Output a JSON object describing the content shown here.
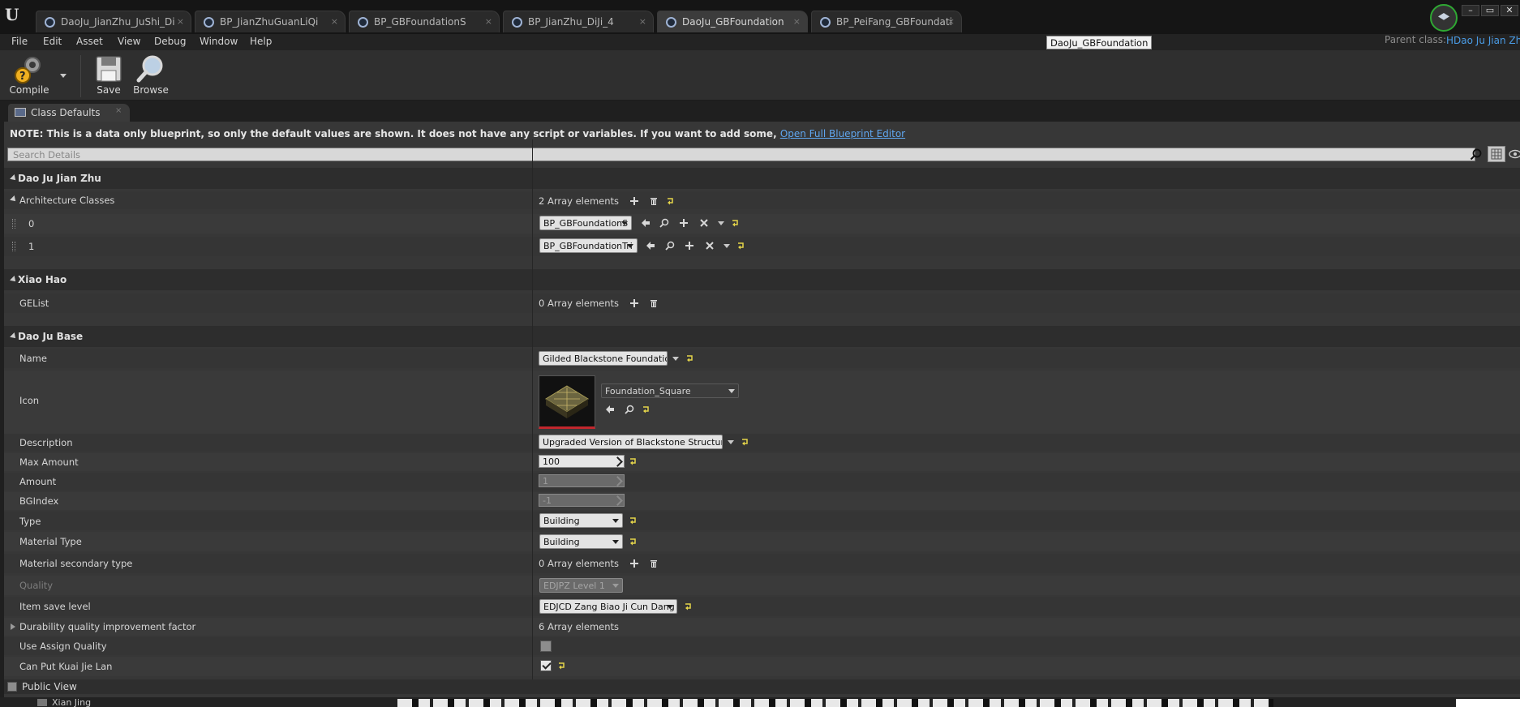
{
  "tabs": [
    {
      "label": "DaoJu_JianZhu_JuShi_Di",
      "active": false
    },
    {
      "label": "BP_JianZhuGuanLiQi",
      "active": false
    },
    {
      "label": "BP_GBFoundationS",
      "active": false
    },
    {
      "label": "BP_JianZhu_DiJi_4",
      "active": false
    },
    {
      "label": "DaoJu_GBFoundation",
      "active": true
    },
    {
      "label": "BP_PeiFang_GBFoundati",
      "active": false
    }
  ],
  "tab_close_glyph": "×",
  "tooltip": "DaoJu_GBFoundation",
  "menu": [
    "File",
    "Edit",
    "Asset",
    "View",
    "Debug",
    "Window",
    "Help"
  ],
  "parent_class": {
    "label": "Parent class:",
    "value": "HDao Ju Jian Zhu"
  },
  "toolbar": {
    "compile": "Compile",
    "save": "Save",
    "browse": "Browse"
  },
  "panel_tab": "Class Defaults",
  "note": {
    "text": "NOTE: This is a data only blueprint, so only the default values are shown.  It does not have any script or variables.  If you want to add some, ",
    "link": "Open Full Blueprint Editor"
  },
  "search_placeholder": "Search Details",
  "categories": {
    "dao_ju_jian_zhu": "Dao Ju Jian Zhu",
    "xiao_hao": "Xiao Hao",
    "dao_ju_base": "Dao Ju Base"
  },
  "architecture_classes": {
    "label": "Architecture Classes",
    "count_text": "2 Array elements",
    "items": [
      {
        "index": "0",
        "value": "BP_GBFoundationS"
      },
      {
        "index": "1",
        "value": "BP_GBFoundationTri"
      }
    ]
  },
  "gelist": {
    "label": "GEList",
    "count_text": "0 Array elements"
  },
  "props": {
    "name": {
      "label": "Name",
      "value": "Gilded Blackstone Foundation"
    },
    "icon": {
      "label": "Icon",
      "value": "Foundation_Square"
    },
    "description": {
      "label": "Description",
      "value": "Upgraded Version of Blackstone Structures"
    },
    "max_amount": {
      "label": "Max Amount",
      "value": "100"
    },
    "amount": {
      "label": "Amount",
      "value": "1"
    },
    "bgindex": {
      "label": "BGIndex",
      "value": "-1"
    },
    "type": {
      "label": "Type",
      "value": "Building"
    },
    "material_type": {
      "label": "Material Type",
      "value": "Building"
    },
    "material_secondary_type": {
      "label": "Material secondary type",
      "value": "0 Array elements"
    },
    "quality": {
      "label": "Quality",
      "value": "EDJPZ Level 1"
    },
    "item_save_level": {
      "label": "Item save level",
      "value": "EDJCD Zang Biao Ji Cun Dang"
    },
    "durability": {
      "label": "Durability quality improvement factor",
      "value": "6 Array elements"
    },
    "use_assign_quality": {
      "label": "Use Assign Quality",
      "checked": false
    },
    "can_put_kuai_jie_lan": {
      "label": "Can Put Kuai Jie Lan",
      "checked": true
    }
  },
  "public_view": "Public View",
  "bottom": {
    "folder_label": "Xian Jing"
  },
  "window_buttons": [
    "–",
    "▭",
    "✕"
  ],
  "colors": {
    "link": "#5fa6ef",
    "reset_arrow": "#e5d54a",
    "profile_ring": "#2fa833"
  }
}
